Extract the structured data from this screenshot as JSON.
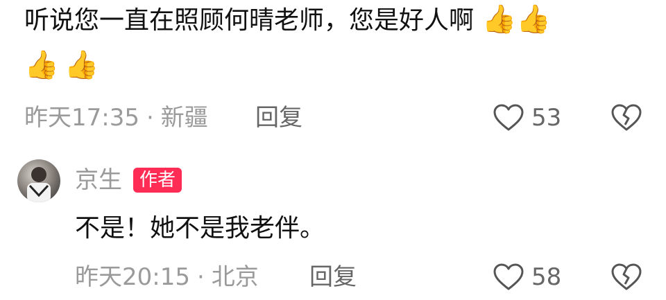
{
  "comment1": {
    "text": "听说您一直在照顾何晴老师，您是好人啊",
    "emoji": "👍",
    "time": "昨天17:35",
    "location": "新疆",
    "reply_label": "回复",
    "likes": "53"
  },
  "comment2": {
    "author": "京生",
    "author_badge": "作者",
    "text": "不是！她不是我老伴。",
    "time": "昨天20:15",
    "location": "北京",
    "reply_label": "回复",
    "likes": "58"
  },
  "separator": "·",
  "colors": {
    "badge_bg": "#ff2d55",
    "meta_text": "#9a9a9a"
  }
}
